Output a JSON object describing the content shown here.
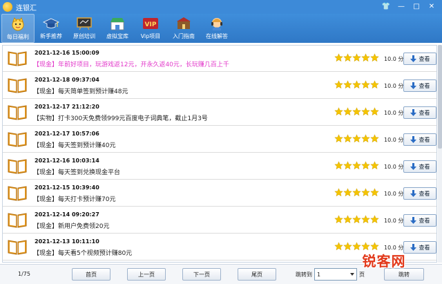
{
  "app": {
    "title": "连银汇"
  },
  "window": {
    "controls": [
      "👕",
      "—",
      "□",
      "✕"
    ]
  },
  "toolbar": {
    "items": [
      {
        "label": "每日福利",
        "icon": "cat-icon",
        "active": true
      },
      {
        "label": "新手推荐",
        "icon": "cap-icon",
        "active": false
      },
      {
        "label": "原创培训",
        "icon": "board-icon",
        "active": false
      },
      {
        "label": "虚拟宝库",
        "icon": "shop-icon",
        "active": false
      },
      {
        "label": "Vip项目",
        "icon": "vip-icon",
        "active": false
      },
      {
        "label": "入门指南",
        "icon": "guide-icon",
        "active": false
      },
      {
        "label": "在线解答",
        "icon": "support-icon",
        "active": false
      }
    ]
  },
  "list": {
    "view_label": "查看",
    "items": [
      {
        "date": "2021-12-16 15:00:09",
        "title": "【现金】年前好项目，玩游戏返12元，开永久返40元，长玩赚几百上千",
        "highlight": true,
        "rating": 5,
        "score": "10.0 分"
      },
      {
        "date": "2021-12-18 09:37:04",
        "title": "【现金】每天简单签到预计赚48元",
        "highlight": false,
        "rating": 5,
        "score": "10.0 分"
      },
      {
        "date": "2021-12-17 21:12:20",
        "title": "【实物】打卡300天免费领999元百度电子词典笔，截止1月3号",
        "highlight": false,
        "rating": 5,
        "score": "10.0 分"
      },
      {
        "date": "2021-12-17 10:57:06",
        "title": "【现金】每天签到预计赚40元",
        "highlight": false,
        "rating": 5,
        "score": "10.0 分"
      },
      {
        "date": "2021-12-16 10:03:14",
        "title": "【现金】每天签到兑换现金平台",
        "highlight": false,
        "rating": 5,
        "score": "10.0 分"
      },
      {
        "date": "2021-12-15 10:39:40",
        "title": "【现金】每天打卡预计赚70元",
        "highlight": false,
        "rating": 5,
        "score": "10.0 分"
      },
      {
        "date": "2021-12-14 09:20:27",
        "title": "【现金】新用户免费领20元",
        "highlight": false,
        "rating": 5,
        "score": "10.0 分"
      },
      {
        "date": "2021-12-13 10:11:10",
        "title": "【现金】每天看5个视频预计赚80元",
        "highlight": false,
        "rating": 5,
        "score": "10.0 分"
      }
    ]
  },
  "pagination": {
    "page_info": "1/75",
    "first": "首页",
    "prev": "上一页",
    "next": "下一页",
    "last": "尾页",
    "jump_label": "跳转到",
    "jump_value": "1",
    "page_unit": "页",
    "jump_button": "跳转"
  },
  "watermark": {
    "text": "锐客网"
  },
  "colors": {
    "titlebar": "#3d8ad8",
    "highlight": "#e236c9",
    "star": "#f5c400"
  }
}
